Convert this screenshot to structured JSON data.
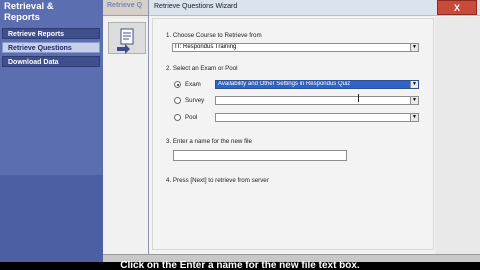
{
  "sidebar": {
    "title_line1": "Retrieval &",
    "title_line2": "Reports",
    "items": [
      {
        "label": "Retrieve Reports"
      },
      {
        "label": "Retrieve Questions"
      },
      {
        "label": "Download Data"
      }
    ]
  },
  "main": {
    "header_label": "Retrieve Q"
  },
  "dialog": {
    "title": "Retrieve Questions Wizard",
    "close_label": "X",
    "step1_label": "1.  Choose Course to Retrieve from",
    "course_value": "IT: Respondus Training",
    "step2_label": "2.  Select an Exam or Pool",
    "options": [
      {
        "label": "Exam",
        "value": "Availability and Other Settings in Respondus Quiz",
        "selected": true
      },
      {
        "label": "Survey",
        "value": "",
        "selected": false
      },
      {
        "label": "Pool",
        "value": "",
        "selected": false
      }
    ],
    "step3_label": "3.  Enter a name for the new file",
    "filename_value": "",
    "step4_label": "4.  Press [Next] to retrieve from server"
  },
  "caption": "Click on the Enter a name for the new file text box."
}
